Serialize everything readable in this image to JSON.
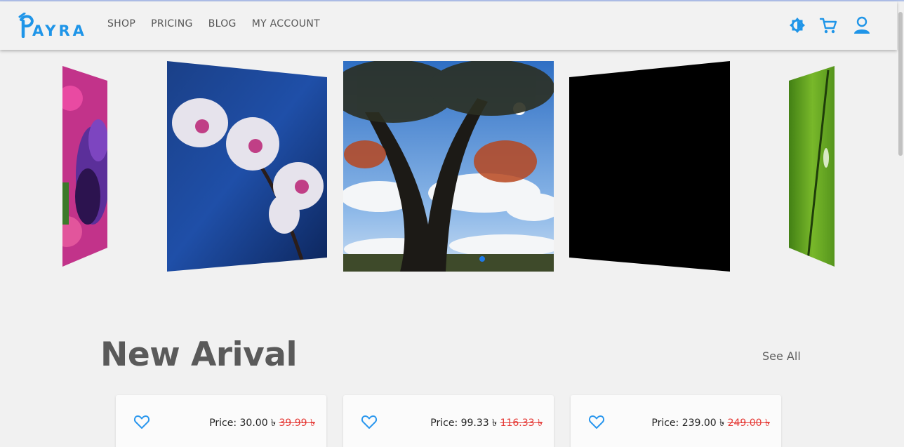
{
  "brand": {
    "logo_text": "AYRA",
    "accent": "#1f95e8"
  },
  "nav": {
    "items": [
      "SHOP",
      "PRICING",
      "BLOG",
      "MY ACCOUNT"
    ]
  },
  "header_icons": [
    "theme-toggle-icon",
    "cart-icon",
    "user-icon"
  ],
  "carousel": {
    "slides": [
      "pansy-flower",
      "white-orchid",
      "autumn-tree-sky",
      "black-slide",
      "green-leaf"
    ],
    "active_index": 2
  },
  "new_arrival": {
    "title": "New Arival",
    "see_all": "See All",
    "products": [
      {
        "price_label": "Price: 30.00 ৳",
        "old_price": "39.99 ৳"
      },
      {
        "price_label": "Price: 99.33 ৳",
        "old_price": "116.33 ৳"
      },
      {
        "price_label": "Price: 239.00 ৳",
        "old_price": "249.00 ৳"
      }
    ]
  }
}
